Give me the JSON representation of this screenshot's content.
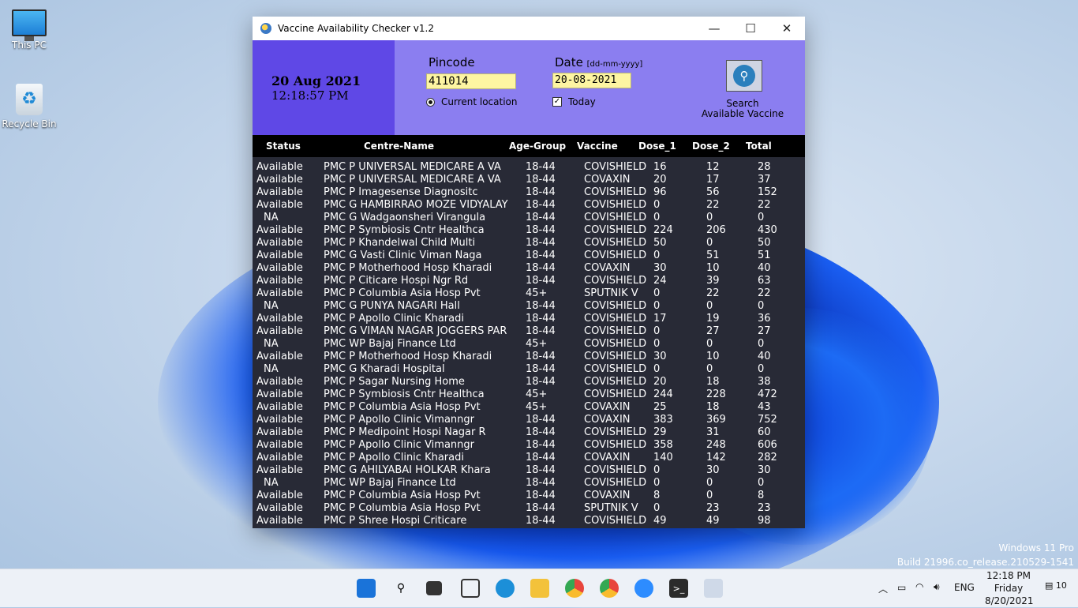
{
  "desktop": {
    "icons": [
      {
        "label": "This PC",
        "icon": "monitor-icon"
      },
      {
        "label": "Recycle Bin",
        "icon": "recycle-bin-icon"
      }
    ],
    "watermark_line1": "Windows 11 Pro",
    "watermark_line2": "Build 21996.co_release.210529-1541"
  },
  "window": {
    "title": "Vaccine Availability Checker  v1.2",
    "minimize": "—",
    "maximize": "☐",
    "close": "✕"
  },
  "header": {
    "date": "20 Aug 2021",
    "time": "12:18:57 PM",
    "pincode_label": "Pincode",
    "pincode_value": "411014",
    "current_location_label": "Current location",
    "date_label": "Date",
    "date_format_hint": "[dd-mm-yyyy]",
    "date_value": "20-08-2021",
    "today_label": "Today",
    "today_checked": true,
    "search_label_line1": "Search",
    "search_label_line2": "Available Vaccine"
  },
  "table": {
    "columns": [
      "Status",
      "Centre-Name",
      "Age-Group",
      "Vaccine",
      "Dose_1",
      "Dose_2",
      "Total"
    ],
    "rows": [
      [
        "Available",
        "PMC P UNIVERSAL MEDICARE A VA",
        "18-44",
        "COVISHIELD",
        "16",
        "12",
        "28"
      ],
      [
        "Available",
        "PMC P UNIVERSAL MEDICARE A VA",
        "18-44",
        "COVAXIN",
        "20",
        "17",
        "37"
      ],
      [
        "Available",
        "PMC P Imagesense Diagnositc",
        "18-44",
        "COVISHIELD",
        "96",
        "56",
        "152"
      ],
      [
        "Available",
        "PMC G HAMBIRRAO MOZE VIDYALAY",
        "18-44",
        "COVISHIELD",
        "0",
        "22",
        "22"
      ],
      [
        "NA",
        "PMC G Wadgaonsheri Virangula",
        "18-44",
        "COVISHIELD",
        "0",
        "0",
        "0"
      ],
      [
        "Available",
        "PMC P Symbiosis Cntr Healthca",
        "18-44",
        "COVISHIELD",
        "224",
        "206",
        "430"
      ],
      [
        "Available",
        "PMC P Khandelwal Child Multi",
        "18-44",
        "COVISHIELD",
        "50",
        "0",
        "50"
      ],
      [
        "Available",
        "PMC G Vasti Clinic Viman Naga",
        "18-44",
        "COVISHIELD",
        "0",
        "51",
        "51"
      ],
      [
        "Available",
        "PMC P Motherhood Hosp Kharadi",
        "18-44",
        "COVAXIN",
        "30",
        "10",
        "40"
      ],
      [
        "Available",
        "PMC P Citicare Hospi Ngr Rd",
        "18-44",
        "COVISHIELD",
        "24",
        "39",
        "63"
      ],
      [
        "Available",
        "PMC P Columbia Asia Hosp Pvt",
        "45+",
        "SPUTNIK V",
        "0",
        "22",
        "22"
      ],
      [
        "NA",
        "PMC G PUNYA NAGARI Hall",
        "18-44",
        "COVISHIELD",
        "0",
        "0",
        "0"
      ],
      [
        "Available",
        "PMC P Apollo Clinic Kharadi",
        "18-44",
        "COVISHIELD",
        "17",
        "19",
        "36"
      ],
      [
        "Available",
        "PMC G VIMAN NAGAR JOGGERS PAR",
        "18-44",
        "COVISHIELD",
        "0",
        "27",
        "27"
      ],
      [
        "NA",
        "PMC WP Bajaj Finance Ltd",
        "45+",
        "COVISHIELD",
        "0",
        "0",
        "0"
      ],
      [
        "Available",
        "PMC P Motherhood Hosp Kharadi",
        "18-44",
        "COVISHIELD",
        "30",
        "10",
        "40"
      ],
      [
        "NA",
        "PMC G Kharadi Hospital",
        "18-44",
        "COVISHIELD",
        "0",
        "0",
        "0"
      ],
      [
        "Available",
        "PMC P Sagar Nursing Home",
        "18-44",
        "COVISHIELD",
        "20",
        "18",
        "38"
      ],
      [
        "Available",
        "PMC P Symbiosis Cntr Healthca",
        "45+",
        "COVISHIELD",
        "244",
        "228",
        "472"
      ],
      [
        "Available",
        "PMC P Columbia Asia Hosp Pvt",
        "45+",
        "COVAXIN",
        "25",
        "18",
        "43"
      ],
      [
        "Available",
        "PMC P Apollo Clinic Vimanngr",
        "18-44",
        "COVAXIN",
        "383",
        "369",
        "752"
      ],
      [
        "Available",
        "PMC P Medipoint Hospi Nagar R",
        "18-44",
        "COVISHIELD",
        "29",
        "31",
        "60"
      ],
      [
        "Available",
        "PMC P Apollo Clinic Vimanngr",
        "18-44",
        "COVISHIELD",
        "358",
        "248",
        "606"
      ],
      [
        "Available",
        "PMC P Apollo Clinic Kharadi",
        "18-44",
        "COVAXIN",
        "140",
        "142",
        "282"
      ],
      [
        "Available",
        "PMC G AHILYABAI HOLKAR Khara",
        "18-44",
        "COVISHIELD",
        "0",
        "30",
        "30"
      ],
      [
        "NA",
        "PMC WP Bajaj Finance Ltd",
        "18-44",
        "COVISHIELD",
        "0",
        "0",
        "0"
      ],
      [
        "Available",
        "PMC P Columbia Asia Hosp Pvt",
        "18-44",
        "COVAXIN",
        "8",
        "0",
        "8"
      ],
      [
        "Available",
        "PMC P Columbia Asia Hosp Pvt",
        "18-44",
        "SPUTNIK V",
        "0",
        "23",
        "23"
      ],
      [
        "Available",
        "PMC P Shree Hospi Criticare",
        "18-44",
        "COVISHIELD",
        "49",
        "49",
        "98"
      ]
    ]
  },
  "taskbar": {
    "apps": [
      "start-icon",
      "search-icon",
      "task-view-icon",
      "widgets-icon",
      "edge-icon",
      "file-explorer-icon",
      "chrome-icon",
      "chrome-alt-icon",
      "zoom-icon",
      "terminal-icon",
      "python-icon"
    ],
    "language": "ENG",
    "clock_time": "12:18 PM",
    "clock_day": "Friday",
    "clock_date": "8/20/2021",
    "notification_count": "10"
  },
  "colors": {
    "date_panel": "#5f48e6",
    "form_panel": "#8b7ef0",
    "table_bg": "#282a36",
    "input_bg": "#fdf5a2"
  }
}
